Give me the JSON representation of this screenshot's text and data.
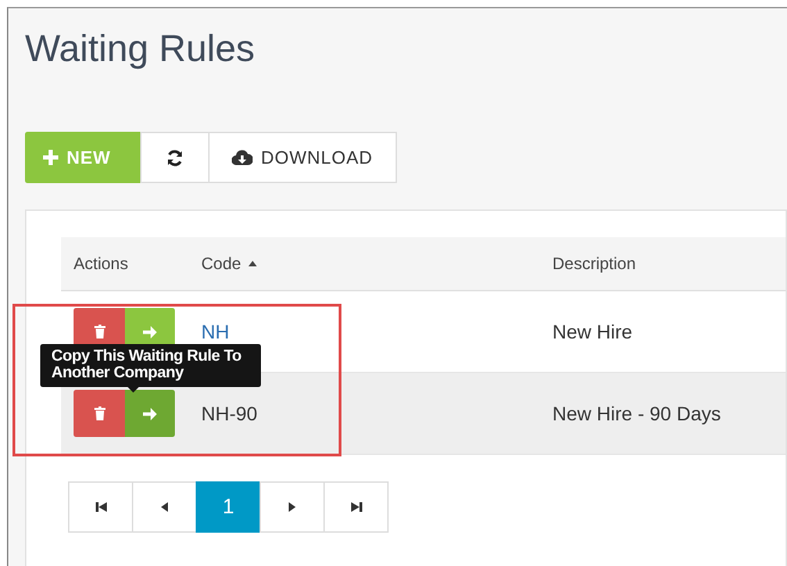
{
  "title": "Waiting Rules",
  "toolbar": [
    {
      "kind": "new",
      "label": "NEW"
    },
    {
      "kind": "refresh"
    },
    {
      "kind": "download",
      "label": "DOWNLOAD"
    }
  ],
  "table": {
    "columns": [
      {
        "label": "Actions",
        "sorted": false
      },
      {
        "label": "Code",
        "sorted": true
      },
      {
        "label": "Description",
        "sorted": false
      }
    ],
    "rows": [
      {
        "code": "NH",
        "description": "New Hire",
        "hovered": false
      },
      {
        "code": "NH-90",
        "description": "New Hire - 90 Days",
        "hovered": true
      }
    ]
  },
  "tooltip": {
    "text": "Copy This Waiting Rule To Another Company"
  },
  "pagination": [
    {
      "kind": "first",
      "selected": false
    },
    {
      "kind": "prev",
      "selected": false
    },
    {
      "kind": "page",
      "label": "1",
      "selected": true
    },
    {
      "kind": "next",
      "selected": false
    },
    {
      "kind": "last",
      "selected": false
    }
  ]
}
